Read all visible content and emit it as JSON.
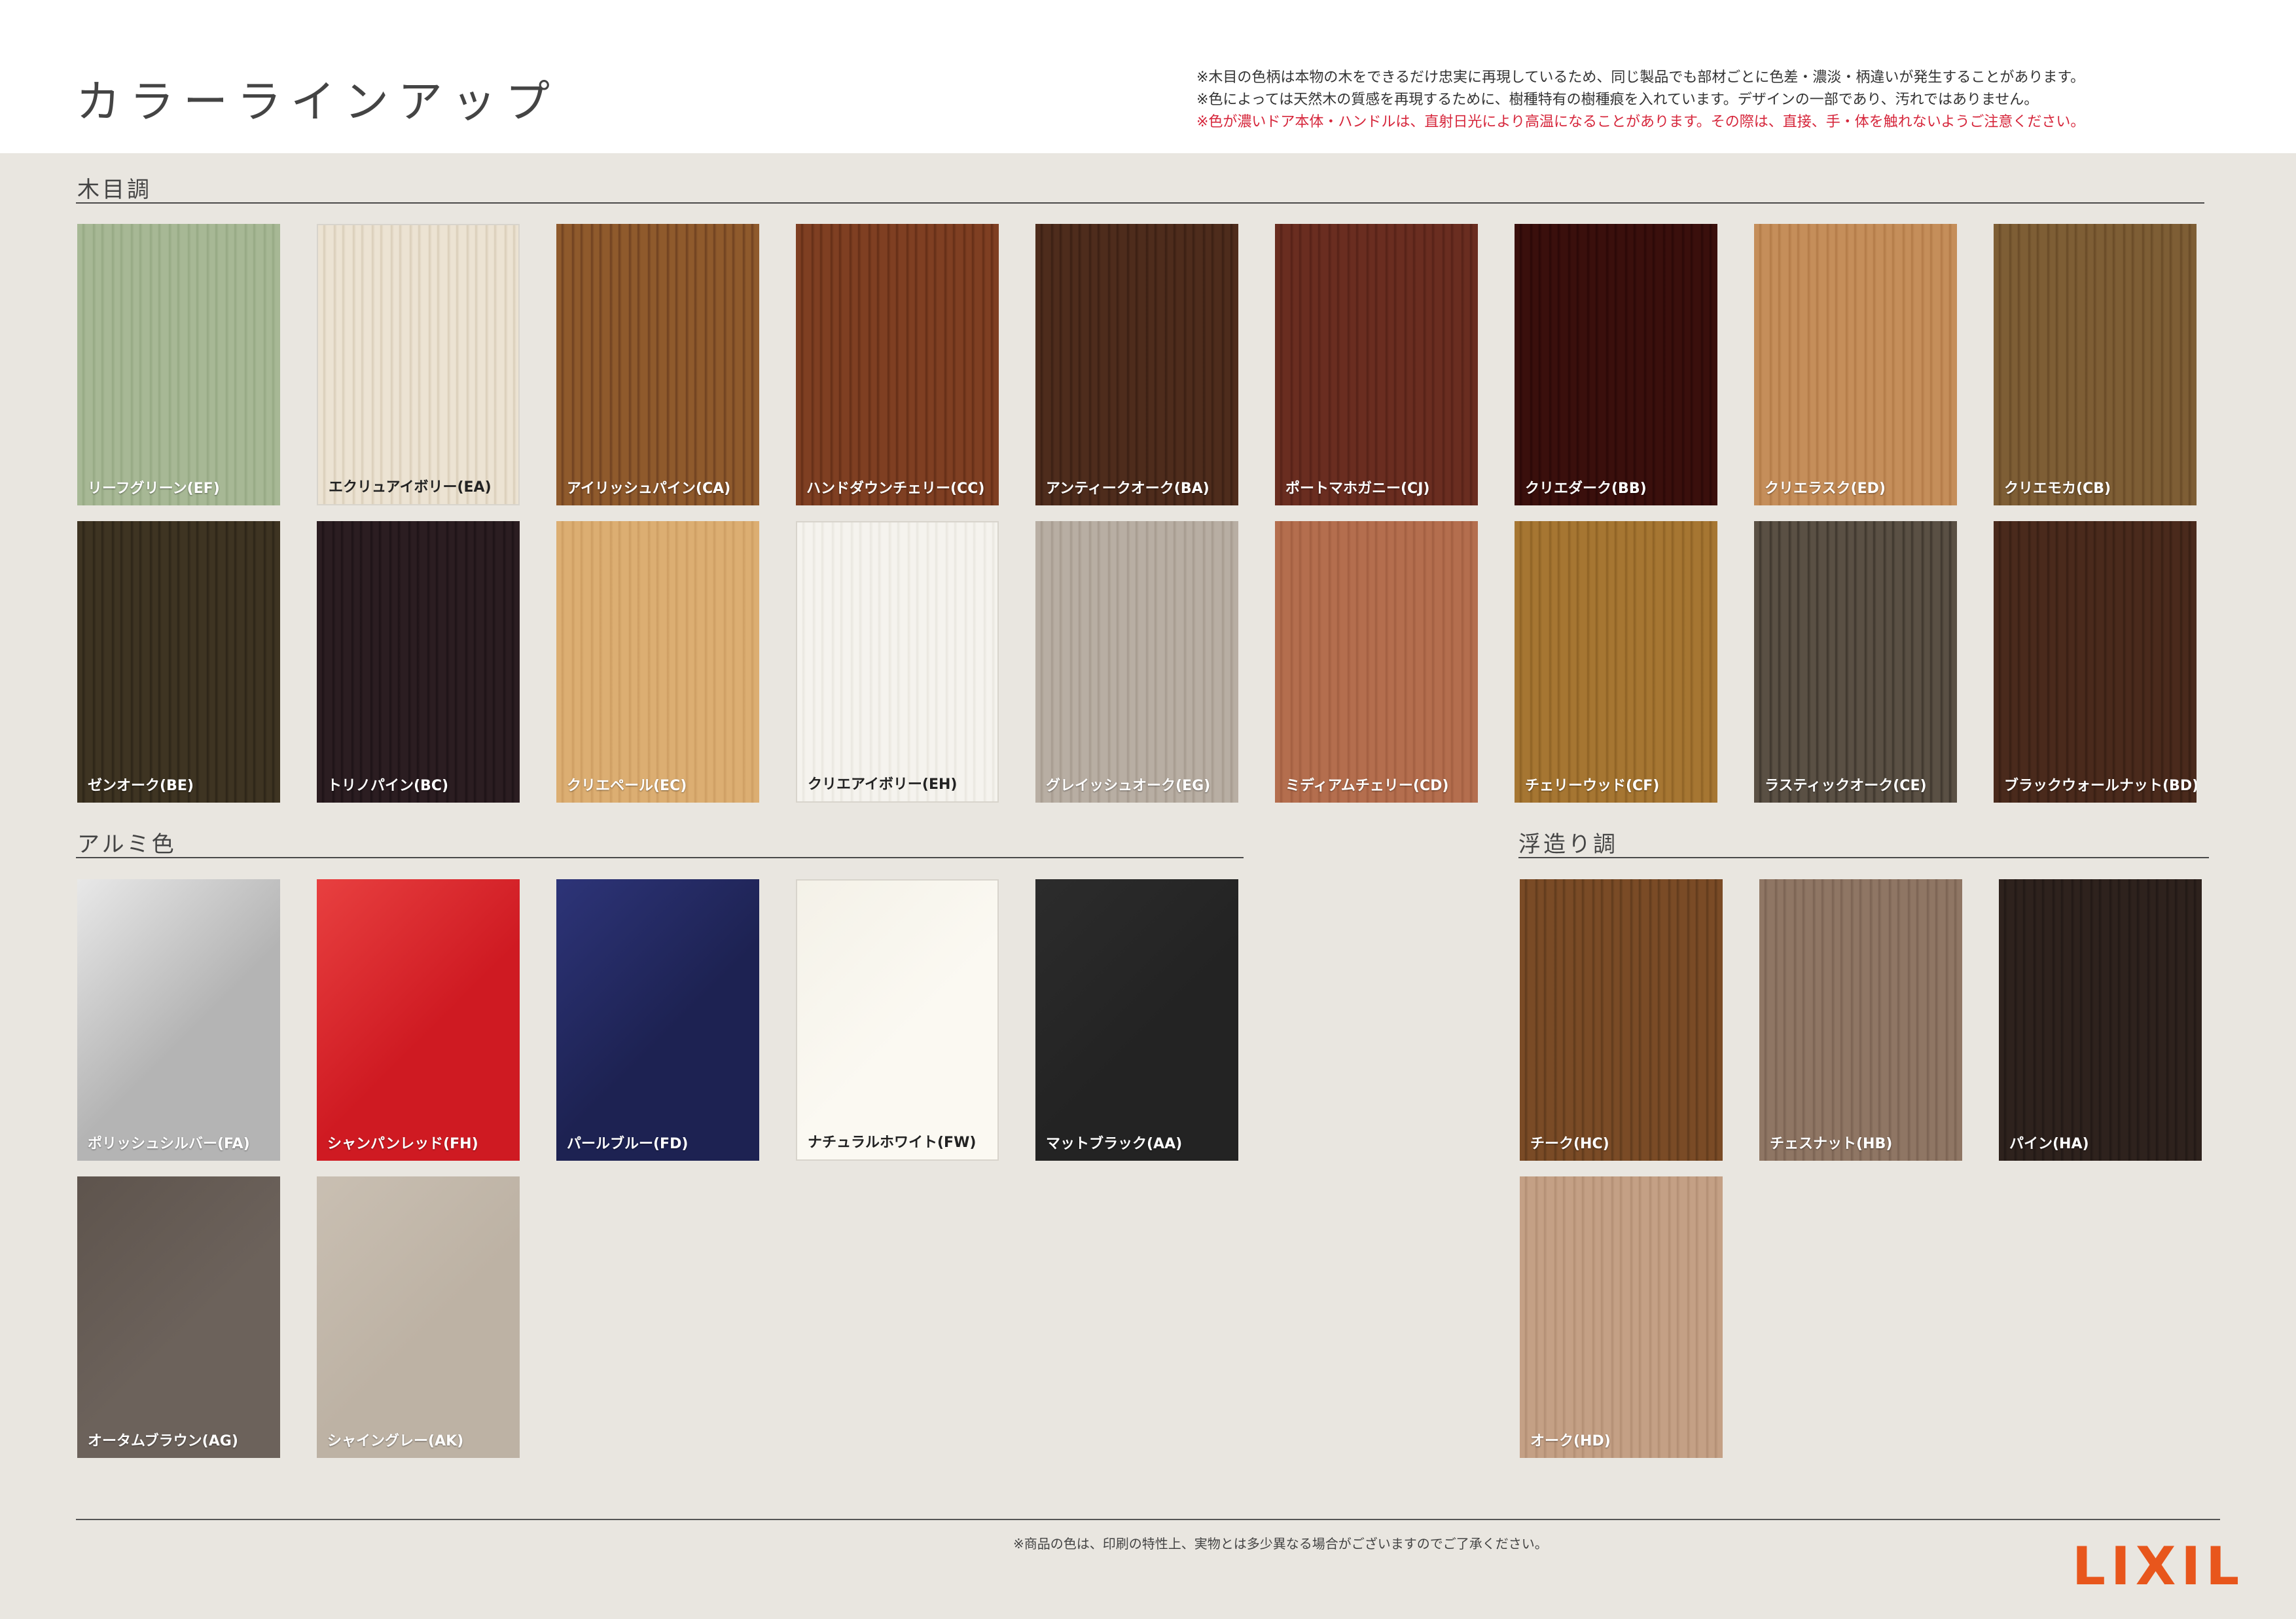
{
  "header": {
    "title": "カラーラインアップ",
    "notes": [
      "※木目の色柄は本物の木をできるだけ忠実に再現しているため、同じ製品でも部材ごとに色差・濃淡・柄違いが発生することがあります。",
      "※色によっては天然木の質感を再現するために、樹種特有の樹種痕を入れています。デザインの一部であり、汚れではありません。"
    ],
    "warning": "※色が濃いドア本体・ハンドルは、直射日光により高温になることがあります。その際は、直接、手・体を触れないようご注意ください。"
  },
  "sections": {
    "mokume": {
      "title": "木目調",
      "swatches": [
        {
          "label": "リーフグリーン(EF)",
          "color": "#a7b895",
          "grain": "#95a883"
        },
        {
          "label": "エクリュアイボリー(EA)",
          "color": "#ece3d3",
          "grain": "#d9cdb8",
          "light": true
        },
        {
          "label": "アイリッシュパイン(CA)",
          "color": "#8f5a2c",
          "grain": "#6e4020"
        },
        {
          "label": "ハンドダウンチェリー(CC)",
          "color": "#7f3f22",
          "grain": "#622d16"
        },
        {
          "label": "アンティークオーク(BA)",
          "color": "#4e2c1c",
          "grain": "#3a1f13"
        },
        {
          "label": "ポートマホガニー(CJ)",
          "color": "#6a2d20",
          "grain": "#552117"
        },
        {
          "label": "クリエダーク(BB)",
          "color": "#3a0f0c",
          "grain": "#2a0807"
        },
        {
          "label": "クリエラスク(ED)",
          "color": "#c58e5a",
          "grain": "#b27a47"
        },
        {
          "label": "クリエモカ(CB)",
          "color": "#7e5e35",
          "grain": "#684a27"
        },
        {
          "label": "ゼンオーク(BE)",
          "color": "#3e3422",
          "grain": "#2c2417"
        },
        {
          "label": "トリノパイン(BC)",
          "color": "#2b1d21",
          "grain": "#1d1216"
        },
        {
          "label": "クリエペール(EC)",
          "color": "#dcae72",
          "grain": "#cd9d62"
        },
        {
          "label": "クリエアイボリー(EH)",
          "color": "#f5f3ee",
          "grain": "#e9e6df",
          "light": true
        },
        {
          "label": "グレイッシュオーク(EG)",
          "color": "#b8aea3",
          "grain": "#a59a8e"
        },
        {
          "label": "ミディアムチェリー(CD)",
          "color": "#b46e4e",
          "grain": "#a15e40"
        },
        {
          "label": "チェリーウッド(CF)",
          "color": "#a67632",
          "grain": "#8d6124"
        },
        {
          "label": "ラスティックオーク(CE)",
          "color": "#5a5044",
          "grain": "#3d352c"
        },
        {
          "label": "ブラックウォールナット(BD)",
          "color": "#4a2a1c",
          "grain": "#371e13"
        }
      ]
    },
    "alumi": {
      "title": "アルミ色",
      "swatches": [
        {
          "label": "ポリッシュシルバー(FA)",
          "color": "#b4b4b4",
          "grain": "#e8e8e8"
        },
        {
          "label": "シャンパンレッド(FH)",
          "color": "#cf1a22",
          "grain": "#e84040"
        },
        {
          "label": "パールブルー(FD)",
          "color": "#1d2252",
          "grain": "#2d3478"
        },
        {
          "label": "ナチュラルホワイト(FW)",
          "color": "#fbf9f2",
          "grain": "#f4f1e8",
          "light": true
        },
        {
          "label": "マットブラック(AA)",
          "color": "#232323",
          "grain": "#2c2c2c"
        },
        {
          "label": "オータムブラウン(AG)",
          "color": "#6c625b",
          "grain": "#5e544d"
        },
        {
          "label": "シャイングレー(AK)",
          "color": "#bdb2a4",
          "grain": "#c9bfb2"
        }
      ]
    },
    "ukizukuri": {
      "title": "浮造り調",
      "swatches": [
        {
          "label": "チーク(HC)",
          "color": "#7a4b26",
          "grain": "#5f3a1c"
        },
        {
          "label": "チェスナット(HB)",
          "color": "#8f7664",
          "grain": "#7a6252"
        },
        {
          "label": "パイン(HA)",
          "color": "#2e221d",
          "grain": "#211815"
        },
        {
          "label": "オーク(HD)",
          "color": "#c4a085",
          "grain": "#b28e73"
        }
      ]
    }
  },
  "footer": {
    "note": "※商品の色は、印刷の特性上、実物とは多少異なる場合がございますのでご了承ください。",
    "logo": "LIXIL"
  }
}
